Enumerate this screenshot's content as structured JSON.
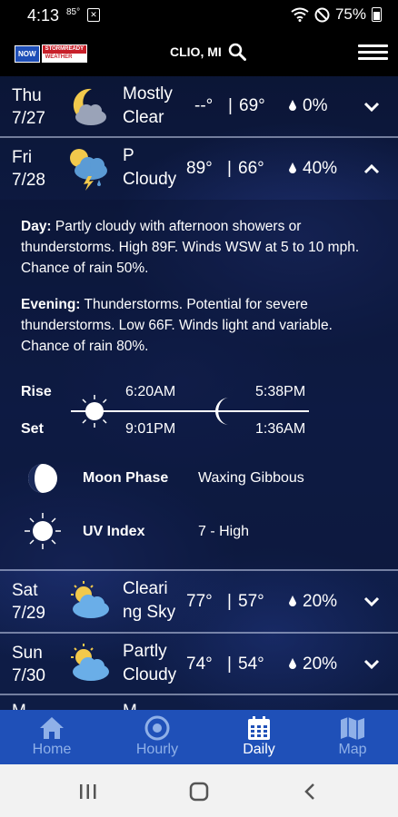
{
  "status_bar": {
    "time": "4:13",
    "temp": "85°",
    "notif": "✕",
    "battery": "75%"
  },
  "header": {
    "logo_a": "NOW",
    "logo_b1": "STORMREADY",
    "logo_b2": "WEATHER",
    "location": "CLIO, MI"
  },
  "days": [
    {
      "dow": "Thu",
      "date": "7/27",
      "cond1": "Mostly",
      "cond2": "Clear",
      "hi": "--°",
      "lo": "69°",
      "rain": "0%",
      "icon": "moon-cloud-icon"
    },
    {
      "dow": "Fri",
      "date": "7/28",
      "cond1": "P",
      "cond2": "Cloudy",
      "hi": "89°",
      "lo": "66°",
      "rain": "40%",
      "icon": "thunderstorm-icon"
    },
    {
      "dow": "Sat",
      "date": "7/29",
      "cond1": "Cleari",
      "cond2": "ng Sky",
      "hi": "77°",
      "lo": "57°",
      "rain": "20%",
      "icon": "partly-cloudy-icon"
    },
    {
      "dow": "Sun",
      "date": "7/30",
      "cond1": "Partly",
      "cond2": "Cloudy",
      "hi": "74°",
      "lo": "54°",
      "rain": "20%",
      "icon": "partly-cloudy-icon"
    },
    {
      "dow": "M",
      "date": "",
      "cond1": "M",
      "cond2": "",
      "hi": "",
      "lo": "",
      "rain": "",
      "icon": ""
    }
  ],
  "sep": "|",
  "detail": {
    "day_label": "Day:",
    "day_text": " Partly cloudy with afternoon showers or thunderstorms. High 89F. Winds WSW at 5 to 10 mph. Chance of rain 50%.",
    "evening_label": "Evening:",
    "evening_text": " Thunderstorms. Potential for severe thunderstorms. Low 66F. Winds light and variable. Chance of rain 80%.",
    "rise_label": "Rise",
    "set_label": "Set",
    "sunrise": "6:20AM",
    "sunset": "9:01PM",
    "moonrise": "5:38PM",
    "moonset": "1:36AM",
    "moon_phase_label": "Moon Phase",
    "moon_phase_value": "Waxing Gibbous",
    "uv_label": "UV Index",
    "uv_value": "7 - High"
  },
  "nav": {
    "home": "Home",
    "hourly": "Hourly",
    "daily": "Daily",
    "map": "Map",
    "active": "Daily"
  }
}
